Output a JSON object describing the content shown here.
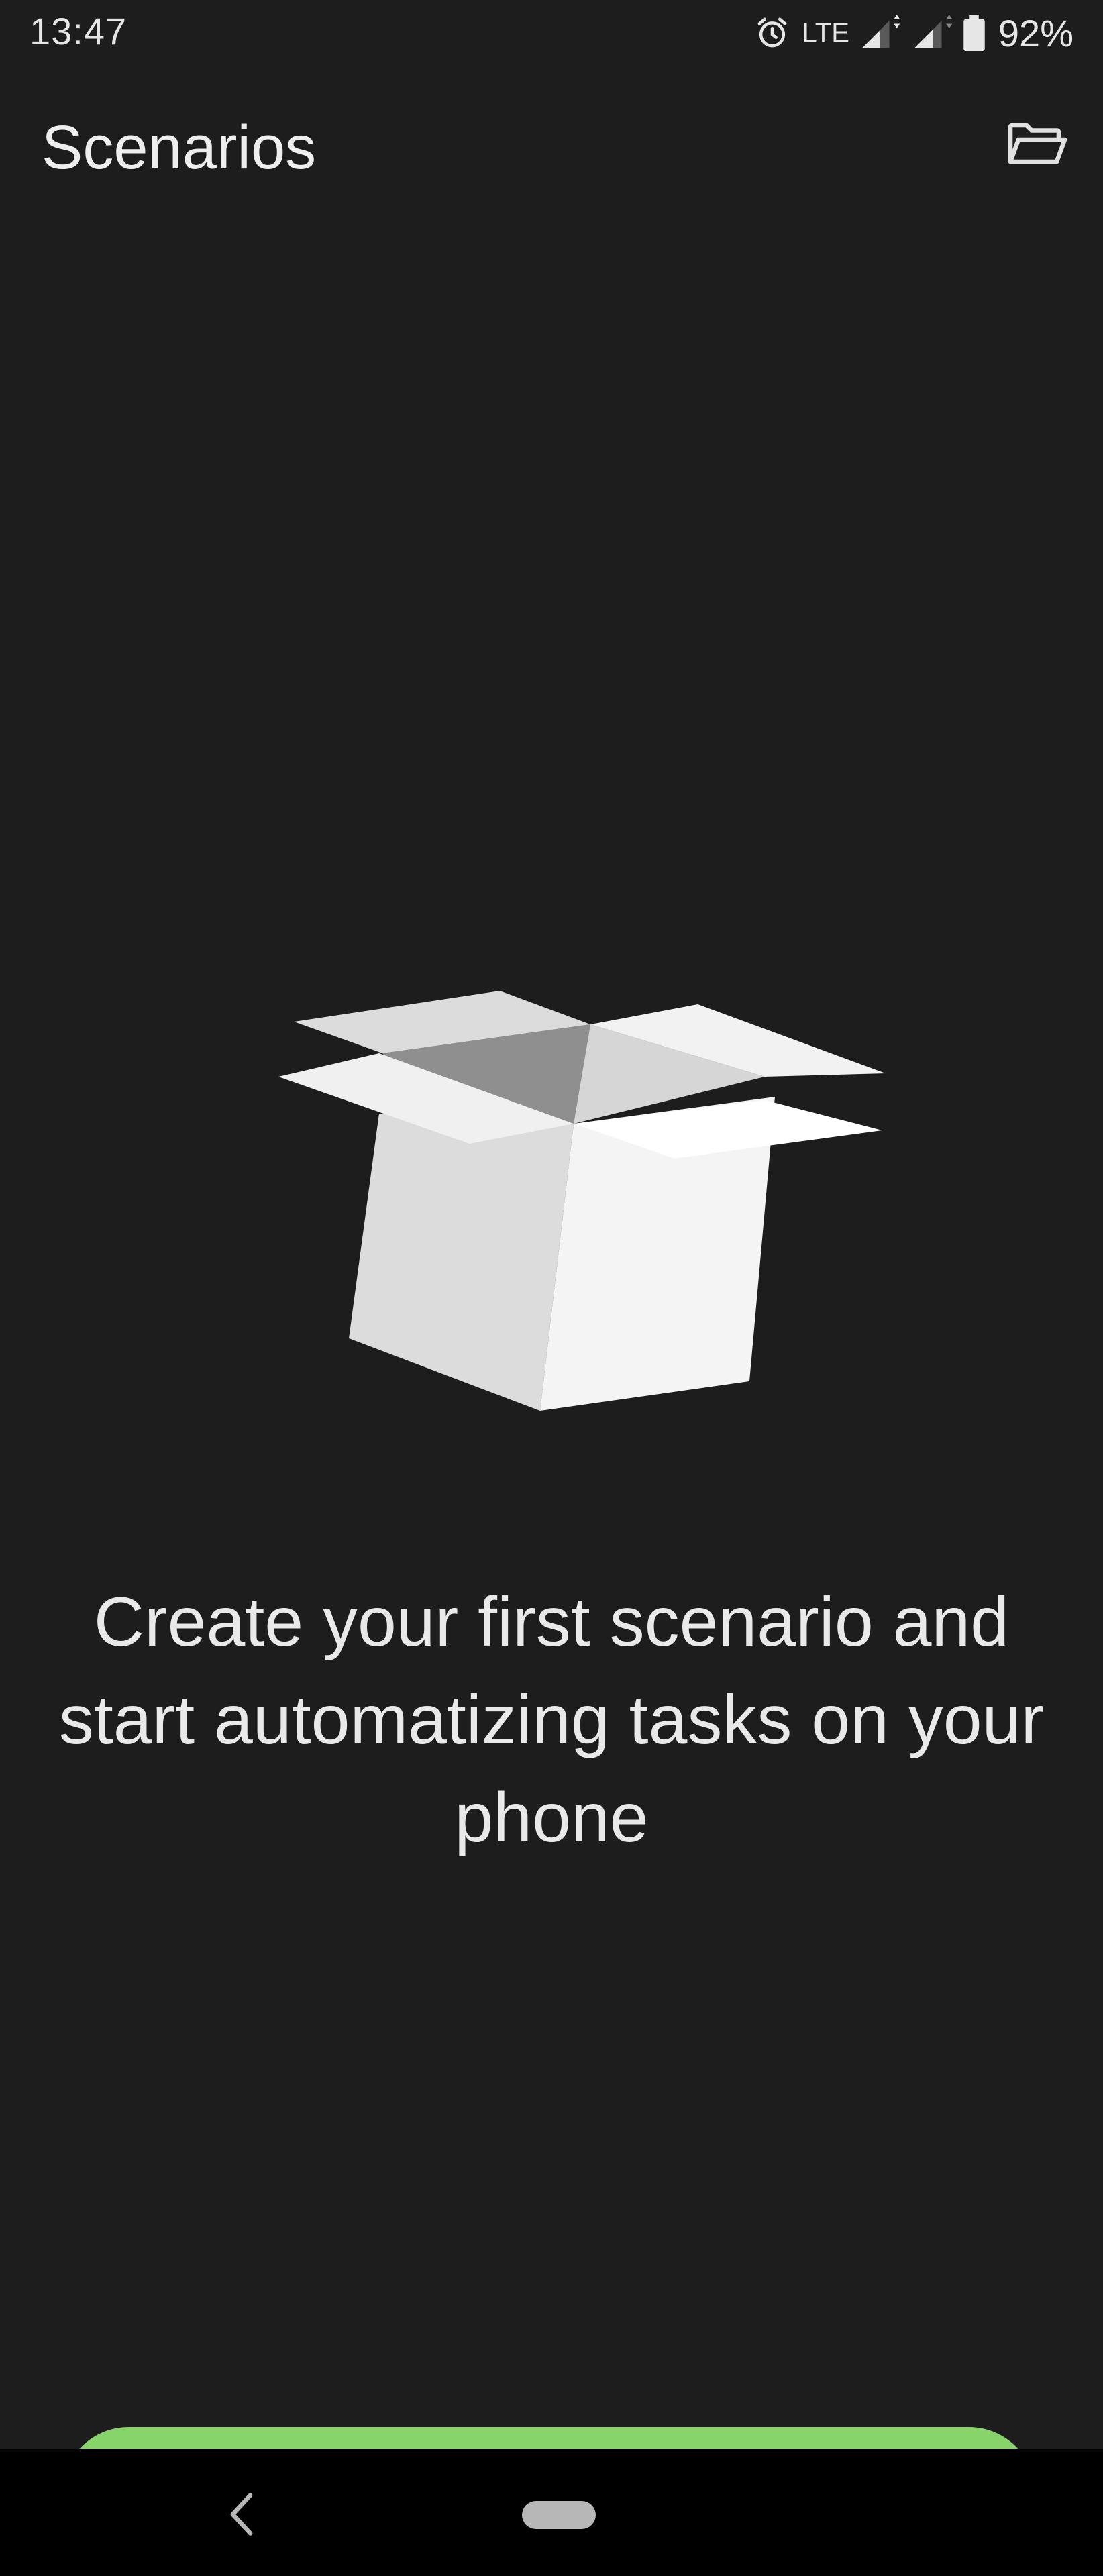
{
  "status_bar": {
    "time": "13:47",
    "network": "LTE",
    "battery": "92%",
    "icons": [
      "alarm-icon",
      "signal-icon",
      "signal-icon",
      "battery-icon"
    ]
  },
  "app_bar": {
    "title": "Scenarios",
    "action_icon": "folder-open-icon"
  },
  "empty_state": {
    "illustration_icon": "open-box-icon",
    "message": "Create your first scenario and start automatizing tasks on your phone"
  },
  "bottom_button": {
    "color": "#86d46a"
  },
  "nav_bar": {
    "icons": [
      "back-icon",
      "home-pill"
    ]
  },
  "colors": {
    "background": "#1c1d1c",
    "text": "#e9e9e9",
    "accent": "#86d46a"
  }
}
